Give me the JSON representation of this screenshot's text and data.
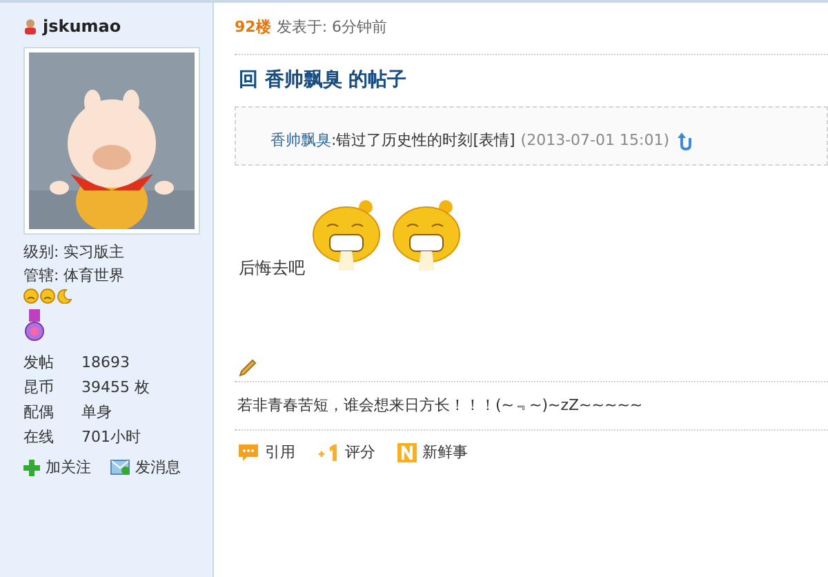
{
  "author": {
    "name": "jskumao",
    "info": [
      {
        "label": "级别:",
        "value": "实习版主"
      },
      {
        "label": "管辖:",
        "value": "体育世界"
      }
    ],
    "stats": [
      {
        "label": "发帖",
        "value": "18693"
      },
      {
        "label": "昆币",
        "value": "39455 枚"
      },
      {
        "label": "配偶",
        "value": "单身"
      },
      {
        "label": "在线",
        "value": "701小时"
      }
    ],
    "actions": [
      {
        "kind": "follow",
        "label": "加关注"
      },
      {
        "kind": "message",
        "label": "发消息"
      }
    ]
  },
  "post": {
    "floor": "92楼",
    "posted": "发表于: 6分钟前",
    "title": "回 香帅飘臭 的帖子",
    "quote": {
      "author": "香帅飘臭",
      "text": ":错过了历史性的时刻[表情]",
      "time": "(2013-07-01 15:01)"
    },
    "body": "后悔去吧",
    "emoticons": [
      {
        "kind": "grin"
      },
      {
        "kind": "grin"
      }
    ],
    "signature": "若非青春苦短，谁会想来日方长！！！(~﹃~)~zZ~~~~~",
    "actions": [
      {
        "kind": "quote",
        "label": "引用"
      },
      {
        "kind": "rate",
        "label": "评分"
      },
      {
        "kind": "share",
        "label": "新鲜事"
      }
    ]
  }
}
